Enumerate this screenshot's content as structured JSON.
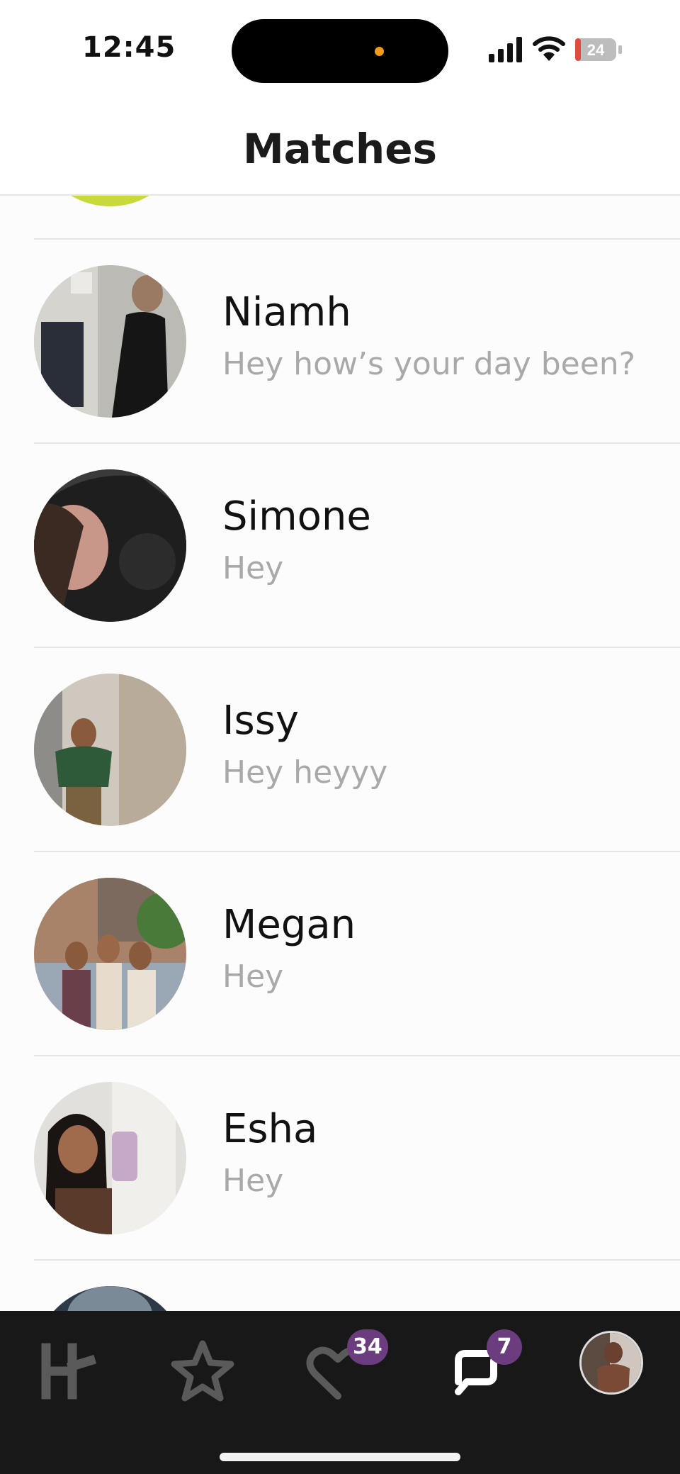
{
  "status_bar": {
    "time": "12:45",
    "battery": "24"
  },
  "header": {
    "title": "Matches"
  },
  "matches": [
    {
      "name": "Niamh",
      "message": "Hey how’s your day been?"
    },
    {
      "name": "Simone",
      "message": "Hey"
    },
    {
      "name": "Issy",
      "message": "Hey heyyy"
    },
    {
      "name": "Megan",
      "message": "Hey"
    },
    {
      "name": "Esha",
      "message": "Hey"
    }
  ],
  "tabbar": {
    "items": [
      {
        "icon": "hinge-logo-icon"
      },
      {
        "icon": "star-icon"
      },
      {
        "icon": "heart-likes-icon",
        "badge": "34"
      },
      {
        "icon": "chat-icon",
        "badge": "7"
      },
      {
        "icon": "profile-avatar"
      }
    ]
  },
  "colors": {
    "badge": "#6b3d7f",
    "tabbar_bg": "#181818",
    "message_text": "#a9a9a9"
  }
}
